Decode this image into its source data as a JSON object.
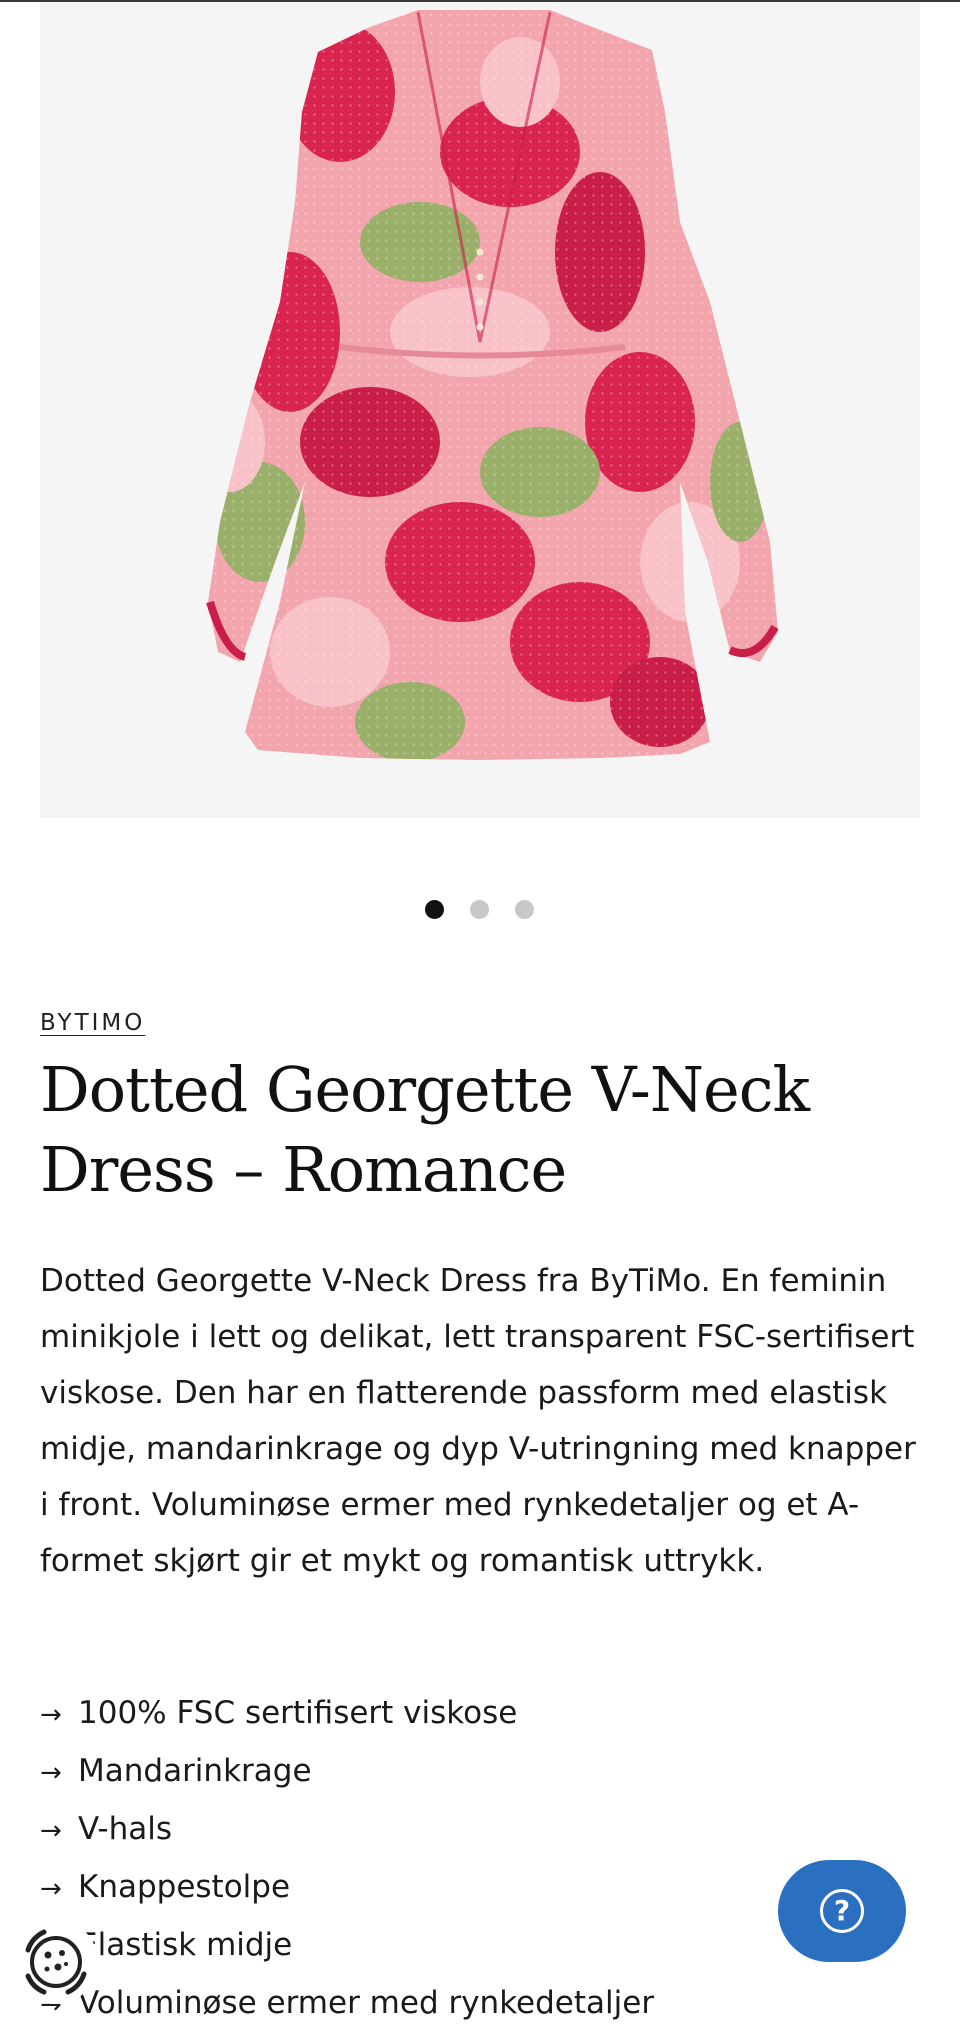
{
  "gallery": {
    "image_alt": "Dotted Georgette V-Neck Dress – Romance",
    "slide_count": 3,
    "active_slide": 1
  },
  "product": {
    "brand": "BYTIMO",
    "title": "Dotted Georgette V-Neck Dress – Romance",
    "description": "Dotted Georgette V-Neck Dress fra ByTiMo. En feminin minikjole i lett og delikat, lett transparent FSC-sertifisert viskose. Den har en flatterende passform med elastisk midje, mandarinkrage og dyp V-utringning med knapper i front. Voluminøse ermer med rynkedetaljer og et A-formet skjørt gir et mykt og romantisk uttrykk.",
    "features": [
      "100% FSC sertifisert viskose",
      "Mandarinkrage",
      "V-hals",
      "Knappestolpe",
      "Elastisk midje",
      "Voluminøse ermer med rynkedetaljer"
    ],
    "feature_arrow": "→"
  },
  "help": {
    "icon": "question-icon",
    "symbol": "?"
  },
  "widget": {
    "icon": "cookie-settings-icon"
  },
  "colors": {
    "accent_blue": "#2a6fc0",
    "dress_pink": "#f19aa6",
    "dress_red": "#d8244f",
    "dress_green": "#9ab06a",
    "gallery_bg": "#f5f5f5"
  }
}
